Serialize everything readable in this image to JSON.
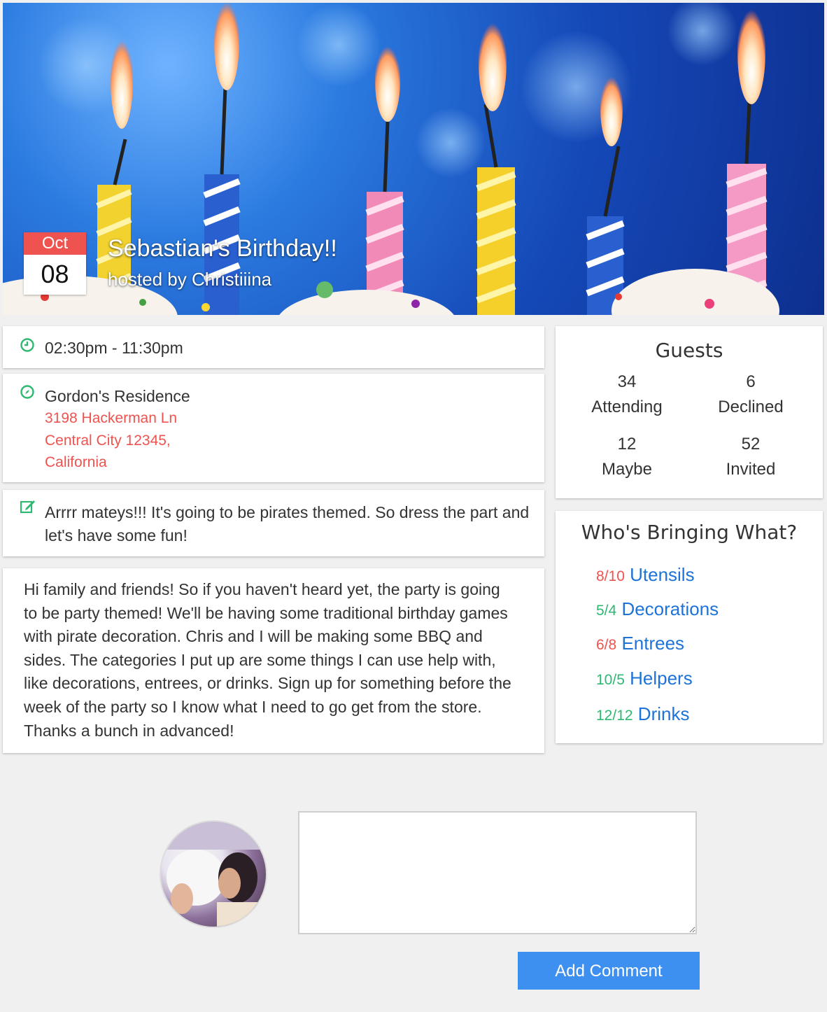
{
  "event": {
    "month": "Oct",
    "day": "08",
    "title": "Sebastian's Birthday!!",
    "host": "hosted by Christiiina",
    "time": "02:30pm - 11:30pm",
    "venue": "Gordon's Residence",
    "address_line1": "3198 Hackerman Ln",
    "address_line2": "Central City 12345,",
    "address_line3": "California",
    "note": "Arrrr mateys!!! It's going to be pirates themed. So dress the part and let's have some fun!",
    "description": "Hi family and friends! So if you haven't heard yet, the party is going to be party themed! We'll be having some traditional birthday games with pirate decoration. Chris and I will be making some BBQ and sides. The categories I put up are some things I can use help with, like decorations, entrees, or drinks. Sign up for something before the week of the party so I know what I need to go get from the store. Thanks a bunch in advanced!"
  },
  "guests": {
    "title": "Guests",
    "attending": {
      "count": "34",
      "label": "Attending"
    },
    "declined": {
      "count": "6",
      "label": "Declined"
    },
    "maybe": {
      "count": "12",
      "label": "Maybe"
    },
    "invited": {
      "count": "52",
      "label": "Invited"
    }
  },
  "bringing": {
    "title": "Who's Bringing What?",
    "items": [
      {
        "count": "8/10",
        "label": "Utensils",
        "status": "red"
      },
      {
        "count": "5/4",
        "label": "Decorations",
        "status": "green"
      },
      {
        "count": "6/8",
        "label": "Entrees",
        "status": "red"
      },
      {
        "count": "10/5",
        "label": "Helpers",
        "status": "green"
      },
      {
        "count": "12/12",
        "label": "Drinks",
        "status": "green"
      }
    ]
  },
  "comment": {
    "placeholder": "",
    "button_label": "Add Comment"
  },
  "colors": {
    "accent_red": "#ef5350",
    "accent_green": "#2eb872",
    "link_blue": "#1e73d8",
    "button_blue": "#3d8ff0"
  },
  "icons": {
    "time": "clock-icon",
    "location": "compass-icon",
    "note": "edit-icon"
  }
}
